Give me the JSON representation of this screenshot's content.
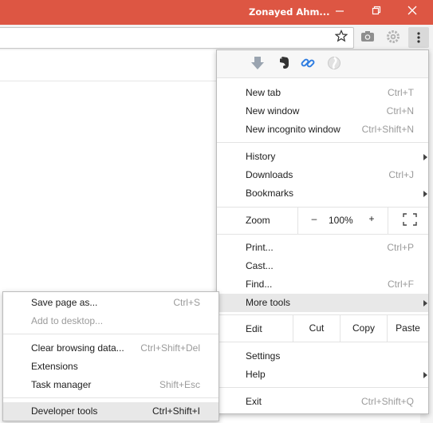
{
  "window": {
    "user_name": "Zonayed Ahm..."
  },
  "extensions": [
    "download-arrow-icon",
    "evernote-icon",
    "link-icon",
    "extension-icon"
  ],
  "menu": {
    "new_tab": {
      "label": "New tab",
      "shortcut": "Ctrl+T"
    },
    "new_window": {
      "label": "New window",
      "shortcut": "Ctrl+N"
    },
    "new_incognito": {
      "label": "New incognito window",
      "shortcut": "Ctrl+Shift+N"
    },
    "history": {
      "label": "History"
    },
    "downloads": {
      "label": "Downloads",
      "shortcut": "Ctrl+J"
    },
    "bookmarks": {
      "label": "Bookmarks"
    },
    "zoom": {
      "label": "Zoom",
      "minus": "–",
      "value": "100%",
      "plus": "+"
    },
    "print": {
      "label": "Print...",
      "shortcut": "Ctrl+P"
    },
    "cast": {
      "label": "Cast..."
    },
    "find": {
      "label": "Find...",
      "shortcut": "Ctrl+F"
    },
    "more_tools": {
      "label": "More tools"
    },
    "edit": {
      "label": "Edit",
      "cut": "Cut",
      "copy": "Copy",
      "paste": "Paste"
    },
    "settings": {
      "label": "Settings"
    },
    "help": {
      "label": "Help"
    },
    "exit": {
      "label": "Exit",
      "shortcut": "Ctrl+Shift+Q"
    }
  },
  "submenu": {
    "save_page": {
      "label": "Save page as...",
      "shortcut": "Ctrl+S"
    },
    "add_desktop": {
      "label": "Add to desktop..."
    },
    "clear_data": {
      "label": "Clear browsing data...",
      "shortcut": "Ctrl+Shift+Del"
    },
    "extensions": {
      "label": "Extensions"
    },
    "task_manager": {
      "label": "Task manager",
      "shortcut": "Shift+Esc"
    },
    "dev_tools": {
      "label": "Developer tools",
      "shortcut": "Ctrl+Shift+I"
    }
  }
}
